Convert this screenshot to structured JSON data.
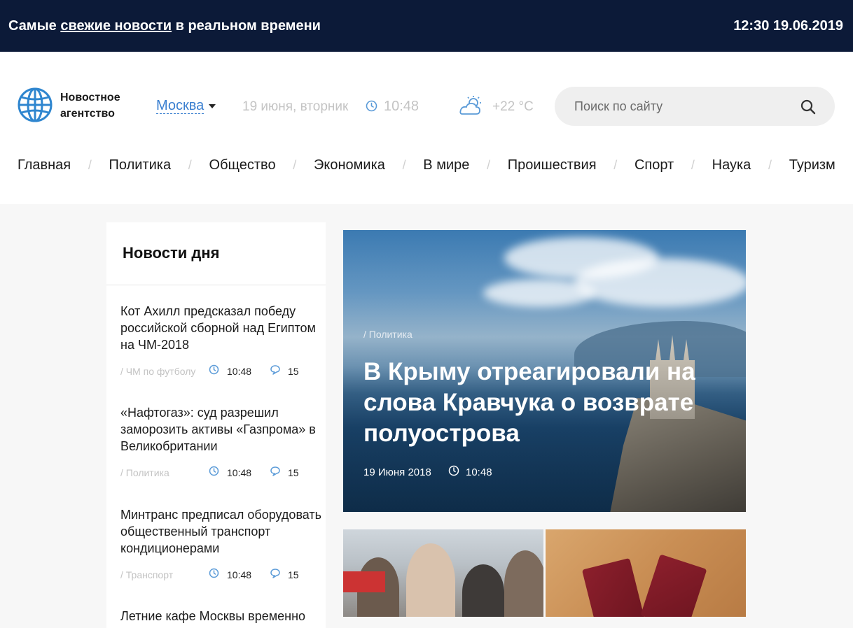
{
  "topbar": {
    "tagline_pre": "Самые ",
    "tagline_link": "свежие новости",
    "tagline_post": " в реальном времени",
    "datetime": "12:30 19.06.2019"
  },
  "header": {
    "logo_line1": "Новостное",
    "logo_line2": "агентство",
    "city": "Москва",
    "date": "19 июня, вторник",
    "time": "10:48",
    "temperature": "+22 °C",
    "search_placeholder": "Поиск по сайту"
  },
  "nav": {
    "items": [
      "Главная",
      "Политика",
      "Общество",
      "Экономика",
      "В мире",
      "Проишествия",
      "Спорт",
      "Наука",
      "Туризм"
    ],
    "separator": "/"
  },
  "sidebar": {
    "title": "Новости дня",
    "items": [
      {
        "title": "Кот Ахилл предсказал победу российской сборной над Египтом на ЧМ-2018",
        "category": "/ ЧМ по футболу",
        "time": "10:48",
        "comments": "15"
      },
      {
        "title": "«Нафтогаз»: суд разрешил заморозить активы «Газпрома» в Великобритании",
        "category": "/ Политика",
        "time": "10:48",
        "comments": "15"
      },
      {
        "title": "Минтранс предписал оборудовать общественный транспорт кондиционерами",
        "category": "/ Транспорт",
        "time": "10:48",
        "comments": "15"
      },
      {
        "title": "Летние кафе Москвы временно"
      }
    ]
  },
  "hero": {
    "category": "/ Политика",
    "title": "В Крыму отреагировали на слова Кравчука о возврате полуострова",
    "date": "19 Июня 2018",
    "time": "10:48"
  },
  "colors": {
    "topbar_bg": "#0c1a38",
    "accent": "#3a7fd0",
    "muted": "#c4c4c4"
  }
}
